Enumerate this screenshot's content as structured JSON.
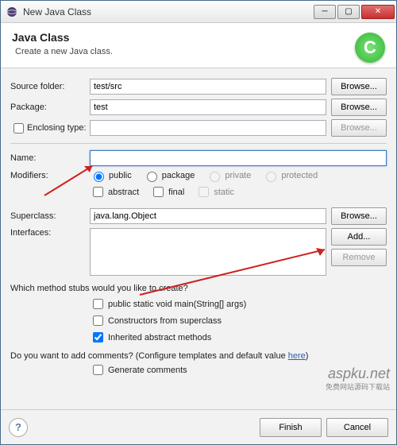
{
  "titlebar": {
    "text": "New Java Class"
  },
  "header": {
    "title": "Java Class",
    "subtitle": "Create a new Java class.",
    "badge_letter": "C"
  },
  "labels": {
    "source_folder": "Source folder:",
    "package": "Package:",
    "enclosing_type": "Enclosing type:",
    "name": "Name:",
    "modifiers": "Modifiers:",
    "superclass": "Superclass:",
    "interfaces": "Interfaces:"
  },
  "values": {
    "source_folder": "test/src",
    "package": "test",
    "enclosing_type": "",
    "name": "",
    "superclass": "java.lang.Object",
    "interfaces": ""
  },
  "buttons": {
    "browse": "Browse...",
    "add": "Add...",
    "remove": "Remove",
    "finish": "Finish",
    "cancel": "Cancel"
  },
  "modifiers": {
    "access": {
      "public": "public",
      "package": "package",
      "private": "private",
      "protected": "protected",
      "selected": "public"
    },
    "other": {
      "abstract": "abstract",
      "final": "final",
      "static": "static"
    }
  },
  "stubs": {
    "question": "Which method stubs would you like to create?",
    "main": "public static void main(String[] args)",
    "constructors": "Constructors from superclass",
    "inherited": "Inherited abstract methods",
    "inherited_checked": true
  },
  "comments": {
    "question_pre": "Do you want to add comments? (Configure templates and default value ",
    "link": "here",
    "question_post": ")",
    "generate": "Generate comments"
  },
  "watermark": {
    "line1": "aspku.net",
    "line2": "免费网站源码下载站"
  }
}
